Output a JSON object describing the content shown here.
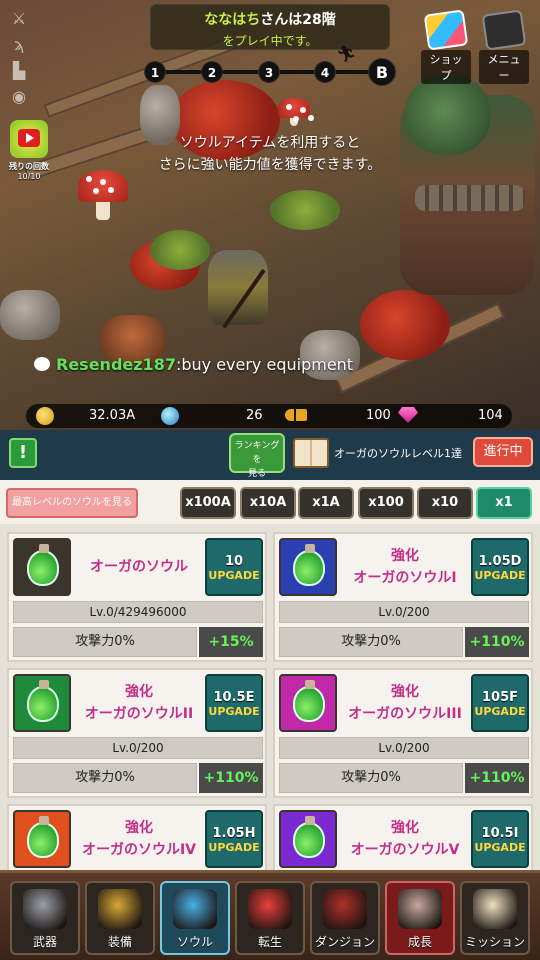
{
  "status_banner": {
    "player_name": "ななはち",
    "floor_text": "さんは28階",
    "line2": "をプレイ中です。"
  },
  "stage_track": {
    "nodes": [
      "1",
      "2",
      "3",
      "4",
      "B"
    ]
  },
  "top_right": {
    "shop_label": "ショップ",
    "menu_label": "メニュー"
  },
  "hint": {
    "line1": "ソウルアイテムを利用すると",
    "line2": "さらに強い能力値を獲得できます。"
  },
  "ad_reward": {
    "label": "残りの回数",
    "count": "10/10"
  },
  "chat": {
    "user": "Resendez187",
    "message": ":buy every equipment"
  },
  "currencies": {
    "gold": "32.03A",
    "orbs": "26",
    "keys": "100",
    "gems": "104"
  },
  "action_strip": {
    "info_label": "!",
    "ranking_line1": "ランキングを",
    "ranking_line2": "見る",
    "achievement_text": "オーガのソウルレベル1達",
    "in_progress_label": "進行中"
  },
  "panel": {
    "view_max_label": "最高レベルのソウルを見る",
    "multipliers": [
      "x100A",
      "x10A",
      "x1A",
      "x100",
      "x10",
      "x1"
    ],
    "selected_multiplier": "x1",
    "cards": [
      {
        "title_line1": "オーガのソウル",
        "title_line2": "",
        "cost": "10",
        "upgrade_label": "UPGADE",
        "level": "Lv.0/429496000",
        "stat": "攻撃力0%",
        "bonus": "+15%",
        "icon_color": "#3b352d"
      },
      {
        "title_line1": "強化",
        "title_line2": "オーガのソウルI",
        "cost": "1.05D",
        "upgrade_label": "UPGADE",
        "level": "Lv.0/200",
        "stat": "攻撃力0%",
        "bonus": "+110%",
        "icon_color": "#2a3fb0"
      },
      {
        "title_line1": "強化",
        "title_line2": "オーガのソウルII",
        "cost": "10.5E",
        "upgrade_label": "UPGADE",
        "level": "Lv.0/200",
        "stat": "攻撃力0%",
        "bonus": "+110%",
        "icon_color": "#1e8a3a"
      },
      {
        "title_line1": "強化",
        "title_line2": "オーガのソウルIII",
        "cost": "105F",
        "upgrade_label": "UPGADE",
        "level": "Lv.0/200",
        "stat": "攻撃力0%",
        "bonus": "+110%",
        "icon_color": "#c02aa8"
      },
      {
        "title_line1": "強化",
        "title_line2": "オーガのソウルIV",
        "cost": "1.05H",
        "upgrade_label": "UPGADE",
        "level": "",
        "stat": "",
        "bonus": "",
        "icon_color": "#e0501e"
      },
      {
        "title_line1": "強化",
        "title_line2": "オーガのソウルV",
        "cost": "10.5I",
        "upgrade_label": "UPGADE",
        "level": "",
        "stat": "",
        "bonus": "",
        "icon_color": "#7a2ad0"
      }
    ]
  },
  "bottom_nav": {
    "tabs": [
      {
        "label": "武器",
        "icon": "crossed-swords-icon",
        "color": "#9aa0a8"
      },
      {
        "label": "装備",
        "icon": "helmet-icon",
        "color": "#d8a838"
      },
      {
        "label": "ソウル",
        "icon": "soul-orb-icon",
        "color": "#4ab0e8"
      },
      {
        "label": "転生",
        "icon": "heart-icon",
        "color": "#e8403a"
      },
      {
        "label": "ダンジョン",
        "icon": "demon-icon",
        "color": "#b0302a"
      },
      {
        "label": "成長",
        "icon": "knight-icon",
        "color": "#c8a8a0"
      },
      {
        "label": "ミッション",
        "icon": "book-icon",
        "color": "#f0e0c0"
      }
    ],
    "selected_tab": "ソウル"
  }
}
